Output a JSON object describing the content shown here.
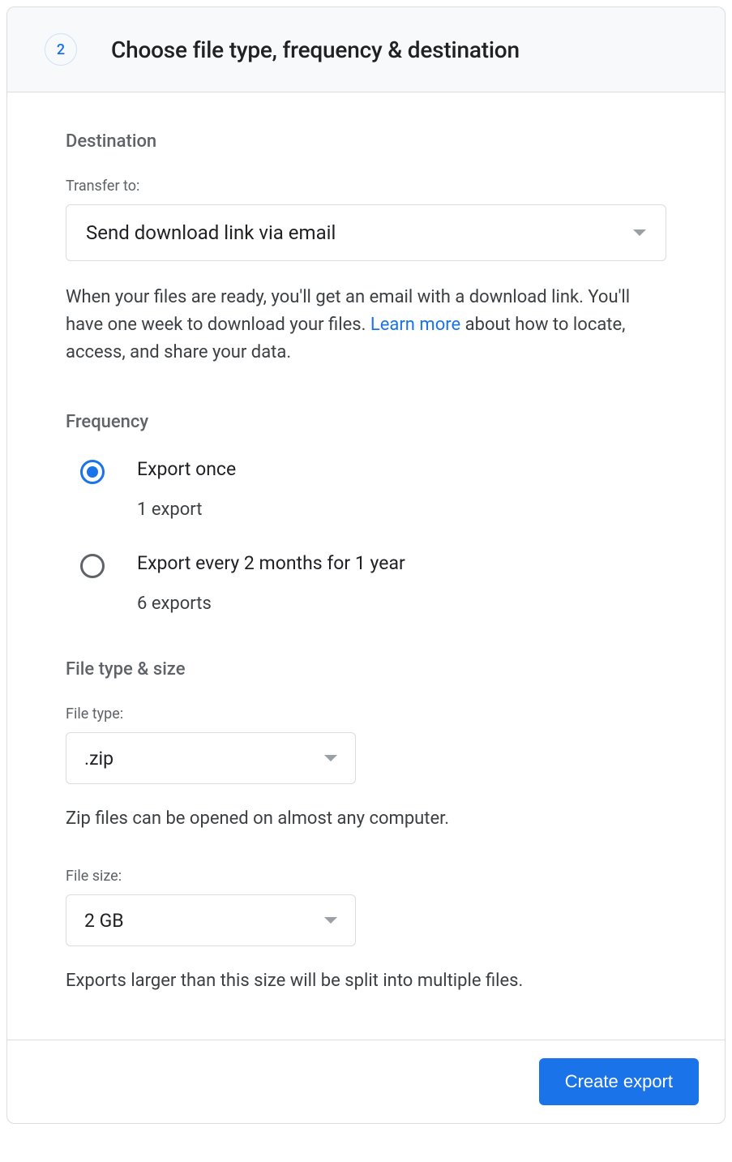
{
  "header": {
    "step_number": "2",
    "title": "Choose file type, frequency & destination"
  },
  "destination": {
    "section_title": "Destination",
    "transfer_label": "Transfer to:",
    "transfer_value": "Send download link via email",
    "description_pre": "When your files are ready, you'll get an email with a download link. You'll have one week to download your files. ",
    "learn_more": "Learn more",
    "description_post": " about how to locate, access, and share your data."
  },
  "frequency": {
    "section_title": "Frequency",
    "options": [
      {
        "title": "Export once",
        "sub": "1 export",
        "selected": true
      },
      {
        "title": "Export every 2 months for 1 year",
        "sub": "6 exports",
        "selected": false
      }
    ]
  },
  "filetype": {
    "section_title": "File type & size",
    "type_label": "File type:",
    "type_value": ".zip",
    "type_helper": "Zip files can be opened on almost any computer.",
    "size_label": "File size:",
    "size_value": "2 GB",
    "size_helper": "Exports larger than this size will be split into multiple files."
  },
  "footer": {
    "create_label": "Create export"
  }
}
